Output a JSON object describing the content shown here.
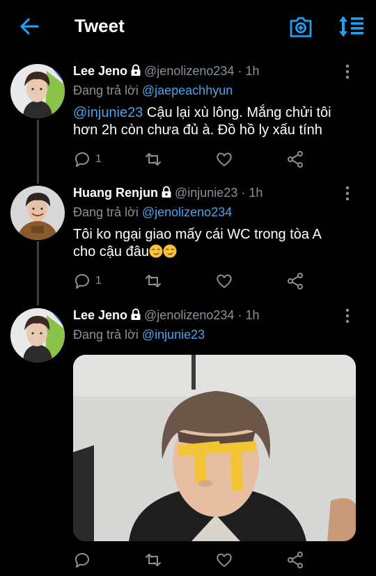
{
  "header": {
    "title": "Tweet"
  },
  "tweets": [
    {
      "name": "Lee Jeno",
      "handle": "@jenolizeno234",
      "dot": "·",
      "time": "1h",
      "reply_prefix": "Đang trả lời",
      "reply_to": "@jaepeachhyun",
      "mention": "@injunie23",
      "text_line1": " Cậu lại xù lông. Mắng chửi tôi",
      "text_line2": "hơn 2h còn chưa đủ à. Đồ hồ ly xấu tính",
      "reply_count": "1"
    },
    {
      "name": "Huang Renjun",
      "handle": "@injunie23",
      "dot": "·",
      "time": "1h",
      "reply_prefix": "Đang trả lời",
      "reply_to": "@jenolizeno234",
      "text_line1": "Tôi ko ngại giao mấy cái WC trong tòa A",
      "text_line2": "cho cậu đâu",
      "reply_count": "1"
    },
    {
      "name": "Lee Jeno",
      "handle": "@jenolizeno234",
      "dot": "·",
      "time": "1h",
      "reply_prefix": "Đang trả lời",
      "reply_to": "@injunie23"
    }
  ],
  "icons": {
    "back": "arrow-left-icon",
    "camera": "camera-icon",
    "sort": "sort-icon",
    "lock": "lock-icon",
    "more": "more-vertical-icon",
    "reply": "reply-icon",
    "retweet": "retweet-icon",
    "like": "heart-icon",
    "share": "share-icon",
    "emoji": "smirk-emoji"
  },
  "colors": {
    "accent": "#1da1f2",
    "mention": "#4aa3ec",
    "background": "#000000",
    "muted": "#8a9299"
  }
}
